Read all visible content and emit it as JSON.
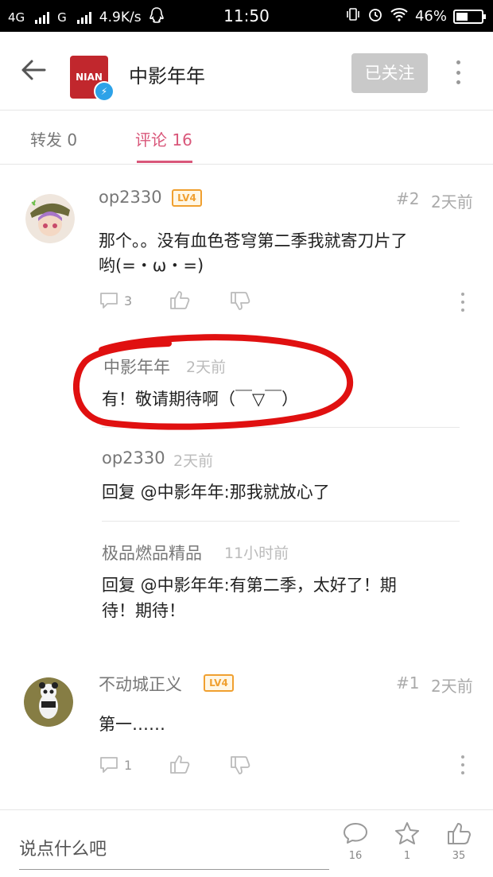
{
  "status_bar": {
    "network1": "4G",
    "network2": "G",
    "speed": "4.9K/s",
    "time": "11:50",
    "battery": "46%",
    "battery_level": 0.46
  },
  "header": {
    "title": "中影年年",
    "follow_label": "已关注",
    "logo_text": "NIAN"
  },
  "tabs": [
    {
      "label": "转发 0"
    },
    {
      "label": "评论 16"
    }
  ],
  "comments": [
    {
      "user": "op2330",
      "level": "LV4",
      "index": "#2",
      "time": "2天前",
      "text_line1": "那个。。没有血色苍穹第二季我就寄刀片了",
      "text_line2": "哟(=・ω・=)",
      "reply_count": "3",
      "replies": [
        {
          "user": "中影年年",
          "time": "2天前",
          "text": "有！敬请期待啊（￣▽￣）"
        },
        {
          "user": "op2330",
          "time": "2天前",
          "text": "回复 @中影年年:那我就放心了"
        },
        {
          "user": "极品燃品精品",
          "time": "11小时前",
          "text_line1": "回复 @中影年年:有第二季，太好了！期",
          "text_line2": "待！期待！"
        }
      ]
    },
    {
      "user": "不动城正义",
      "level": "LV4",
      "index": "#1",
      "time": "2天前",
      "text": "第一……",
      "reply_count": "1"
    }
  ],
  "bottom_bar": {
    "placeholder": "说点什么吧",
    "comment_count": "16",
    "favorite_count": "1",
    "like_count": "35"
  },
  "colors": {
    "accent": "#d9577a",
    "level_badge": "#f0a030",
    "annotation_circle": "#e01010"
  }
}
